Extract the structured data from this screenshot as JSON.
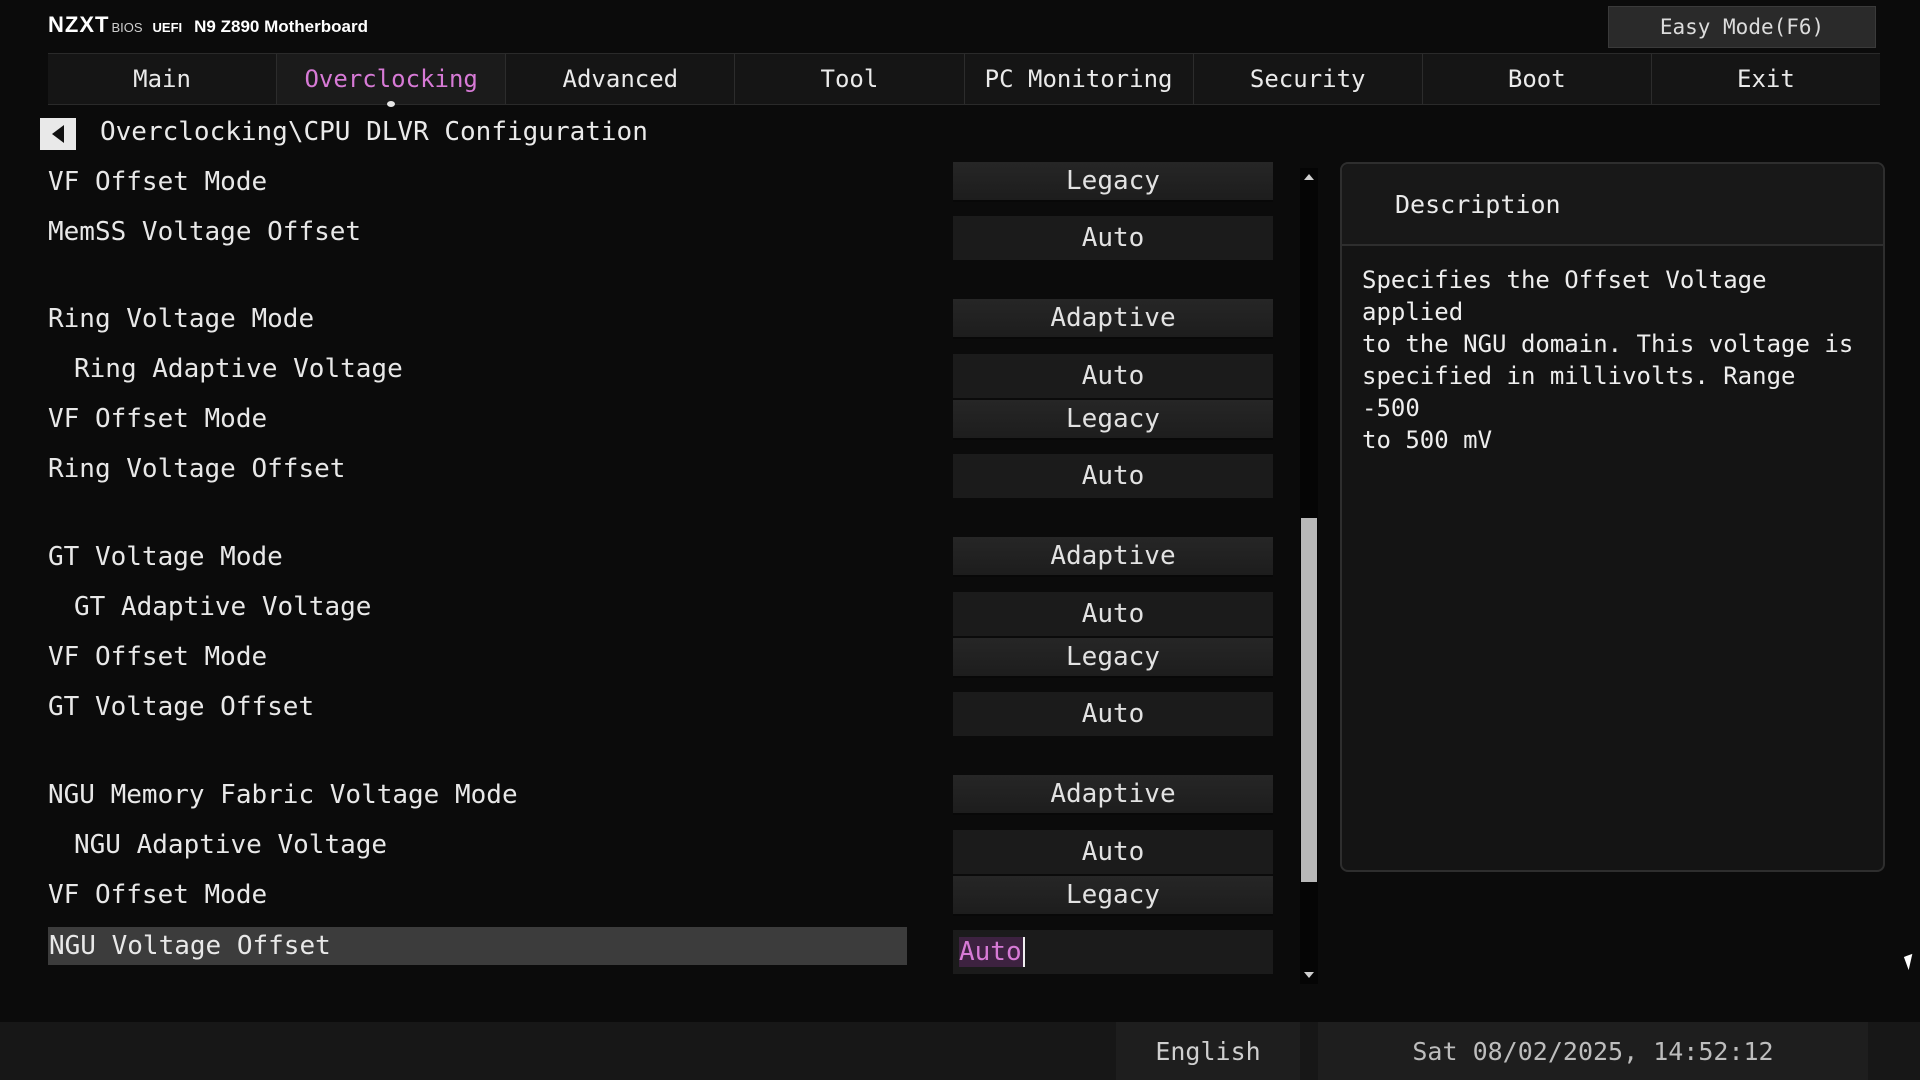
{
  "header": {
    "logo": "NZXT",
    "bios": "BIOS",
    "uefi": "UEFI",
    "model": "N9 Z890 Motherboard",
    "easy_mode": "Easy Mode(F6)"
  },
  "tabs": [
    {
      "label": "Main",
      "active": false
    },
    {
      "label": "Overclocking",
      "active": true
    },
    {
      "label": "Advanced",
      "active": false
    },
    {
      "label": "Tool",
      "active": false
    },
    {
      "label": "PC Monitoring",
      "active": false
    },
    {
      "label": "Security",
      "active": false
    },
    {
      "label": "Boot",
      "active": false
    },
    {
      "label": "Exit",
      "active": false
    }
  ],
  "breadcrumb": "Overclocking\\CPU DLVR Configuration",
  "settings": [
    {
      "label": "VF Offset Mode",
      "value": "Legacy"
    },
    {
      "label": "MemSS Voltage Offset",
      "value": "Auto"
    },
    {
      "label": "Ring Voltage Mode",
      "value": "Adaptive"
    },
    {
      "label": "Ring Adaptive Voltage",
      "value": "Auto"
    },
    {
      "label": "VF Offset Mode",
      "value": "Legacy"
    },
    {
      "label": "Ring Voltage Offset",
      "value": "Auto"
    },
    {
      "label": "GT Voltage Mode",
      "value": "Adaptive"
    },
    {
      "label": "GT Adaptive Voltage",
      "value": "Auto"
    },
    {
      "label": "VF Offset Mode",
      "value": "Legacy"
    },
    {
      "label": "GT Voltage Offset",
      "value": "Auto"
    },
    {
      "label": "NGU Memory Fabric Voltage Mode",
      "value": "Adaptive"
    },
    {
      "label": "NGU Adaptive Voltage",
      "value": "Auto"
    },
    {
      "label": "VF Offset Mode",
      "value": "Legacy"
    },
    {
      "label": "NGU Voltage Offset",
      "value": "Auto"
    }
  ],
  "description": {
    "title": "Description",
    "text": "Specifies the Offset Voltage applied\nto the NGU domain. This voltage is\nspecified in millivolts. Range -500\nto 500 mV"
  },
  "footer": {
    "language": "English",
    "datetime": "Sat 08/02/2025, 14:52:12"
  },
  "colors": {
    "accent": "#d77ad6",
    "background": "#0b0b0b"
  }
}
